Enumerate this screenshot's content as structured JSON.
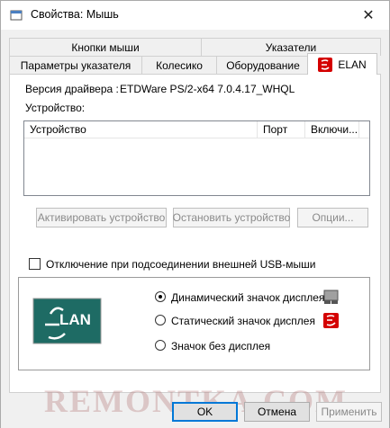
{
  "window": {
    "title": "Свойства: Мышь",
    "close_glyph": "✕",
    "icon": "mouse-properties-icon"
  },
  "tabs_row1": [
    {
      "label": "Кнопки мыши"
    },
    {
      "label": "Указатели"
    }
  ],
  "tabs_row2": [
    {
      "label": "Параметры указателя"
    },
    {
      "label": "Колесико"
    },
    {
      "label": "Оборудование"
    },
    {
      "label": "ELAN",
      "active": true,
      "icon": "elan-icon"
    }
  ],
  "driver": {
    "label": "Версия драйвера :",
    "value": "ETDWare PS/2-x64 7.0.4.17_WHQL"
  },
  "devices": {
    "label": "Устройство:",
    "columns": [
      "Устройство",
      "Порт",
      "Включи..."
    ],
    "rows": []
  },
  "buttons": {
    "activate": "Активировать устройство",
    "stop": "Остановить устройство",
    "options": "Опции..."
  },
  "usb_checkbox": {
    "label": "Отключение при подсоединении внешней USB-мыши",
    "checked": false
  },
  "display_icon": {
    "options": [
      {
        "label": "Динамический значок дисплея",
        "selected": true,
        "icon": "touchpad-icon"
      },
      {
        "label": "Статический значок дисплея",
        "selected": false,
        "icon": "elan-red-icon"
      },
      {
        "label": "Значок без дисплея",
        "selected": false
      }
    ],
    "logo_text": "LAN",
    "logo_letter": "E"
  },
  "footer": {
    "ok": "OK",
    "cancel": "Отмена",
    "apply": "Применить"
  },
  "watermark": "REMONTKA.COM",
  "colors": {
    "accent": "#0078d7",
    "elan_red": "#d40000",
    "elan_teal": "#1e6b64"
  }
}
